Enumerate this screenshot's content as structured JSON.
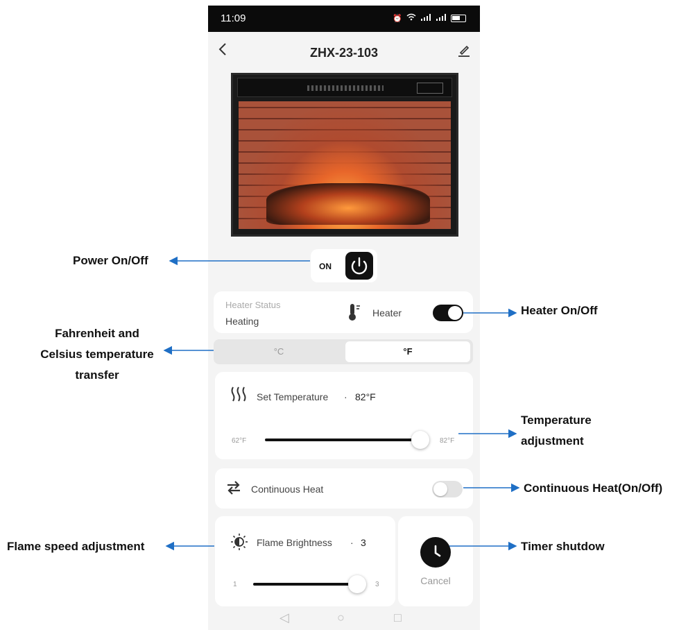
{
  "status_bar": {
    "time": "11:09",
    "icons": [
      "alarm-icon",
      "bluetooth-icon",
      "vibrate-icon",
      "wifi-icon",
      "signal-icon",
      "signal-icon",
      "battery-icon"
    ]
  },
  "header": {
    "title": "ZHX-23-103",
    "back_icon": "chevron-left-icon",
    "edit_icon": "edit-pencil-icon"
  },
  "power": {
    "label": "ON",
    "icon": "power-icon"
  },
  "heater": {
    "status_label": "Heater Status",
    "status_value": "Heating",
    "label": "Heater",
    "icon": "thermometer-icon",
    "on": true
  },
  "units": {
    "celsius": "°C",
    "fahrenheit": "°F",
    "selected": "fahrenheit"
  },
  "temperature": {
    "label": "Set Temperature",
    "separator": "·",
    "value": "82°F",
    "min_label": "62°F",
    "max_label": "82°F",
    "min": 62,
    "max": 82,
    "current": 82
  },
  "continuous_heat": {
    "label": "Continuous Heat",
    "icon": "swap-arrows-icon",
    "on": false
  },
  "flame": {
    "label": "Flame Brightness",
    "separator": "·",
    "value": "3",
    "min_label": "1",
    "max_label": "3",
    "min": 1,
    "max": 3,
    "current": 3,
    "icon": "brightness-icon"
  },
  "timer": {
    "icon": "clock-icon",
    "cancel_label": "Cancel"
  },
  "system_nav": {
    "back": "◁",
    "home": "○",
    "recents": "□"
  },
  "annotations": {
    "power": "Power On/Off",
    "heater": "Heater On/Off",
    "units_line1": "Fahrenheit and",
    "units_line2": "Celsius temperature",
    "units_line3": "transfer",
    "temp_line1": "Temperature",
    "temp_line2": "adjustment",
    "continuous": "Continuous Heat(On/Off)",
    "flame": "Flame speed adjustment",
    "timer": "Timer shutdow"
  },
  "colors": {
    "accent": "#111111",
    "arrow": "#1f6fc5",
    "background": "#f4f4f4"
  }
}
